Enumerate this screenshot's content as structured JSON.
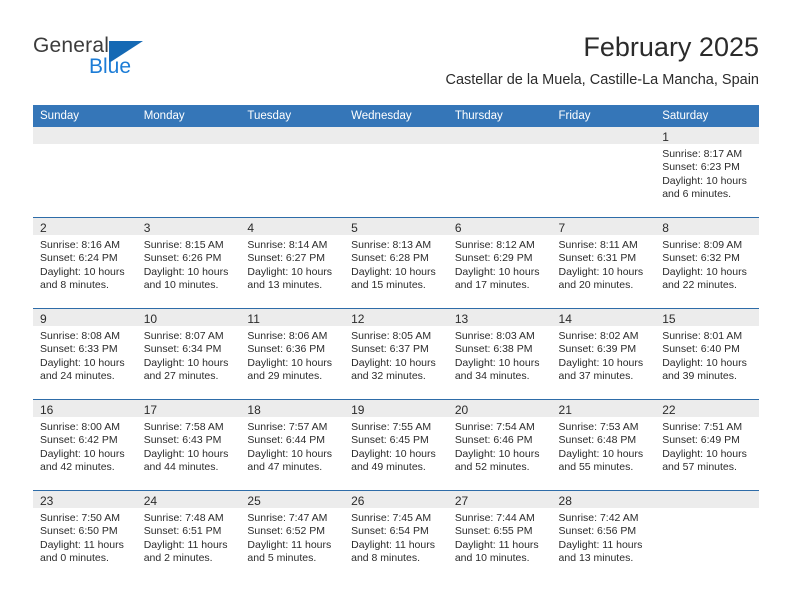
{
  "brand": {
    "word1": "General",
    "word2": "Blue",
    "logo_icon": "triangle-flag-icon"
  },
  "header": {
    "title": "February 2025",
    "subtitle": "Castellar de la Muela, Castille-La Mancha, Spain"
  },
  "colors": {
    "header_blue": "#3576b8",
    "row_divider_blue": "#2e6ca8",
    "daynum_band": "#ececec",
    "brand_blue": "#1c7cd6"
  },
  "calendar": {
    "weekday_headers": [
      "Sunday",
      "Monday",
      "Tuesday",
      "Wednesday",
      "Thursday",
      "Friday",
      "Saturday"
    ],
    "weeks": [
      [
        {
          "blank": true
        },
        {
          "blank": true
        },
        {
          "blank": true
        },
        {
          "blank": true
        },
        {
          "blank": true
        },
        {
          "blank": true
        },
        {
          "day": "1",
          "sunrise": "Sunrise: 8:17 AM",
          "sunset": "Sunset: 6:23 PM",
          "daylight1": "Daylight: 10 hours",
          "daylight2": "and 6 minutes."
        }
      ],
      [
        {
          "day": "2",
          "sunrise": "Sunrise: 8:16 AM",
          "sunset": "Sunset: 6:24 PM",
          "daylight1": "Daylight: 10 hours",
          "daylight2": "and 8 minutes."
        },
        {
          "day": "3",
          "sunrise": "Sunrise: 8:15 AM",
          "sunset": "Sunset: 6:26 PM",
          "daylight1": "Daylight: 10 hours",
          "daylight2": "and 10 minutes."
        },
        {
          "day": "4",
          "sunrise": "Sunrise: 8:14 AM",
          "sunset": "Sunset: 6:27 PM",
          "daylight1": "Daylight: 10 hours",
          "daylight2": "and 13 minutes."
        },
        {
          "day": "5",
          "sunrise": "Sunrise: 8:13 AM",
          "sunset": "Sunset: 6:28 PM",
          "daylight1": "Daylight: 10 hours",
          "daylight2": "and 15 minutes."
        },
        {
          "day": "6",
          "sunrise": "Sunrise: 8:12 AM",
          "sunset": "Sunset: 6:29 PM",
          "daylight1": "Daylight: 10 hours",
          "daylight2": "and 17 minutes."
        },
        {
          "day": "7",
          "sunrise": "Sunrise: 8:11 AM",
          "sunset": "Sunset: 6:31 PM",
          "daylight1": "Daylight: 10 hours",
          "daylight2": "and 20 minutes."
        },
        {
          "day": "8",
          "sunrise": "Sunrise: 8:09 AM",
          "sunset": "Sunset: 6:32 PM",
          "daylight1": "Daylight: 10 hours",
          "daylight2": "and 22 minutes."
        }
      ],
      [
        {
          "day": "9",
          "sunrise": "Sunrise: 8:08 AM",
          "sunset": "Sunset: 6:33 PM",
          "daylight1": "Daylight: 10 hours",
          "daylight2": "and 24 minutes."
        },
        {
          "day": "10",
          "sunrise": "Sunrise: 8:07 AM",
          "sunset": "Sunset: 6:34 PM",
          "daylight1": "Daylight: 10 hours",
          "daylight2": "and 27 minutes."
        },
        {
          "day": "11",
          "sunrise": "Sunrise: 8:06 AM",
          "sunset": "Sunset: 6:36 PM",
          "daylight1": "Daylight: 10 hours",
          "daylight2": "and 29 minutes."
        },
        {
          "day": "12",
          "sunrise": "Sunrise: 8:05 AM",
          "sunset": "Sunset: 6:37 PM",
          "daylight1": "Daylight: 10 hours",
          "daylight2": "and 32 minutes."
        },
        {
          "day": "13",
          "sunrise": "Sunrise: 8:03 AM",
          "sunset": "Sunset: 6:38 PM",
          "daylight1": "Daylight: 10 hours",
          "daylight2": "and 34 minutes."
        },
        {
          "day": "14",
          "sunrise": "Sunrise: 8:02 AM",
          "sunset": "Sunset: 6:39 PM",
          "daylight1": "Daylight: 10 hours",
          "daylight2": "and 37 minutes."
        },
        {
          "day": "15",
          "sunrise": "Sunrise: 8:01 AM",
          "sunset": "Sunset: 6:40 PM",
          "daylight1": "Daylight: 10 hours",
          "daylight2": "and 39 minutes."
        }
      ],
      [
        {
          "day": "16",
          "sunrise": "Sunrise: 8:00 AM",
          "sunset": "Sunset: 6:42 PM",
          "daylight1": "Daylight: 10 hours",
          "daylight2": "and 42 minutes."
        },
        {
          "day": "17",
          "sunrise": "Sunrise: 7:58 AM",
          "sunset": "Sunset: 6:43 PM",
          "daylight1": "Daylight: 10 hours",
          "daylight2": "and 44 minutes."
        },
        {
          "day": "18",
          "sunrise": "Sunrise: 7:57 AM",
          "sunset": "Sunset: 6:44 PM",
          "daylight1": "Daylight: 10 hours",
          "daylight2": "and 47 minutes."
        },
        {
          "day": "19",
          "sunrise": "Sunrise: 7:55 AM",
          "sunset": "Sunset: 6:45 PM",
          "daylight1": "Daylight: 10 hours",
          "daylight2": "and 49 minutes."
        },
        {
          "day": "20",
          "sunrise": "Sunrise: 7:54 AM",
          "sunset": "Sunset: 6:46 PM",
          "daylight1": "Daylight: 10 hours",
          "daylight2": "and 52 minutes."
        },
        {
          "day": "21",
          "sunrise": "Sunrise: 7:53 AM",
          "sunset": "Sunset: 6:48 PM",
          "daylight1": "Daylight: 10 hours",
          "daylight2": "and 55 minutes."
        },
        {
          "day": "22",
          "sunrise": "Sunrise: 7:51 AM",
          "sunset": "Sunset: 6:49 PM",
          "daylight1": "Daylight: 10 hours",
          "daylight2": "and 57 minutes."
        }
      ],
      [
        {
          "day": "23",
          "sunrise": "Sunrise: 7:50 AM",
          "sunset": "Sunset: 6:50 PM",
          "daylight1": "Daylight: 11 hours",
          "daylight2": "and 0 minutes."
        },
        {
          "day": "24",
          "sunrise": "Sunrise: 7:48 AM",
          "sunset": "Sunset: 6:51 PM",
          "daylight1": "Daylight: 11 hours",
          "daylight2": "and 2 minutes."
        },
        {
          "day": "25",
          "sunrise": "Sunrise: 7:47 AM",
          "sunset": "Sunset: 6:52 PM",
          "daylight1": "Daylight: 11 hours",
          "daylight2": "and 5 minutes."
        },
        {
          "day": "26",
          "sunrise": "Sunrise: 7:45 AM",
          "sunset": "Sunset: 6:54 PM",
          "daylight1": "Daylight: 11 hours",
          "daylight2": "and 8 minutes."
        },
        {
          "day": "27",
          "sunrise": "Sunrise: 7:44 AM",
          "sunset": "Sunset: 6:55 PM",
          "daylight1": "Daylight: 11 hours",
          "daylight2": "and 10 minutes."
        },
        {
          "day": "28",
          "sunrise": "Sunrise: 7:42 AM",
          "sunset": "Sunset: 6:56 PM",
          "daylight1": "Daylight: 11 hours",
          "daylight2": "and 13 minutes."
        },
        {
          "blank": true
        }
      ]
    ]
  }
}
